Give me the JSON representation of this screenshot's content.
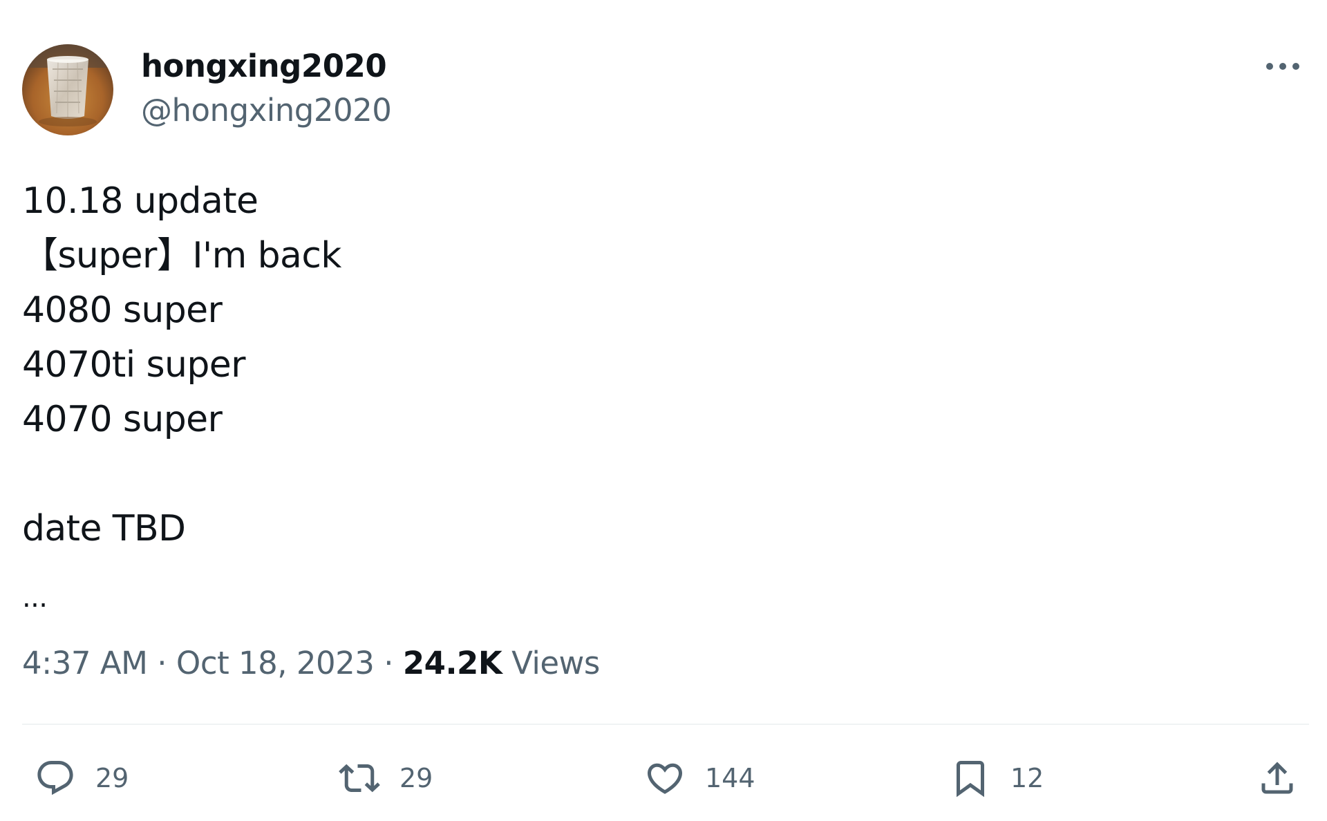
{
  "author": {
    "display_name": "hongxing2020",
    "handle": "@hongxing2020"
  },
  "tweet": {
    "lines": [
      "10.18 update",
      "【super】I'm back",
      "4080 super",
      "4070ti super",
      "4070 super",
      "",
      "date TBD"
    ],
    "ellipsis": "..."
  },
  "meta": {
    "time": "4:37 AM",
    "separator": "·",
    "date": "Oct 18, 2023",
    "views_count": "24.2K",
    "views_label": "Views"
  },
  "actions": {
    "replies": "29",
    "retweets": "29",
    "likes": "144",
    "bookmarks": "12"
  },
  "icons": {
    "more": "more-horizontal-icon",
    "reply": "speech-bubble-icon",
    "retweet": "retweet-arrows-icon",
    "like": "heart-icon",
    "bookmark": "bookmark-icon",
    "share": "share-upload-icon"
  },
  "colors": {
    "text_primary": "#0f1419",
    "text_secondary": "#536471",
    "divider": "#eff3f4"
  }
}
